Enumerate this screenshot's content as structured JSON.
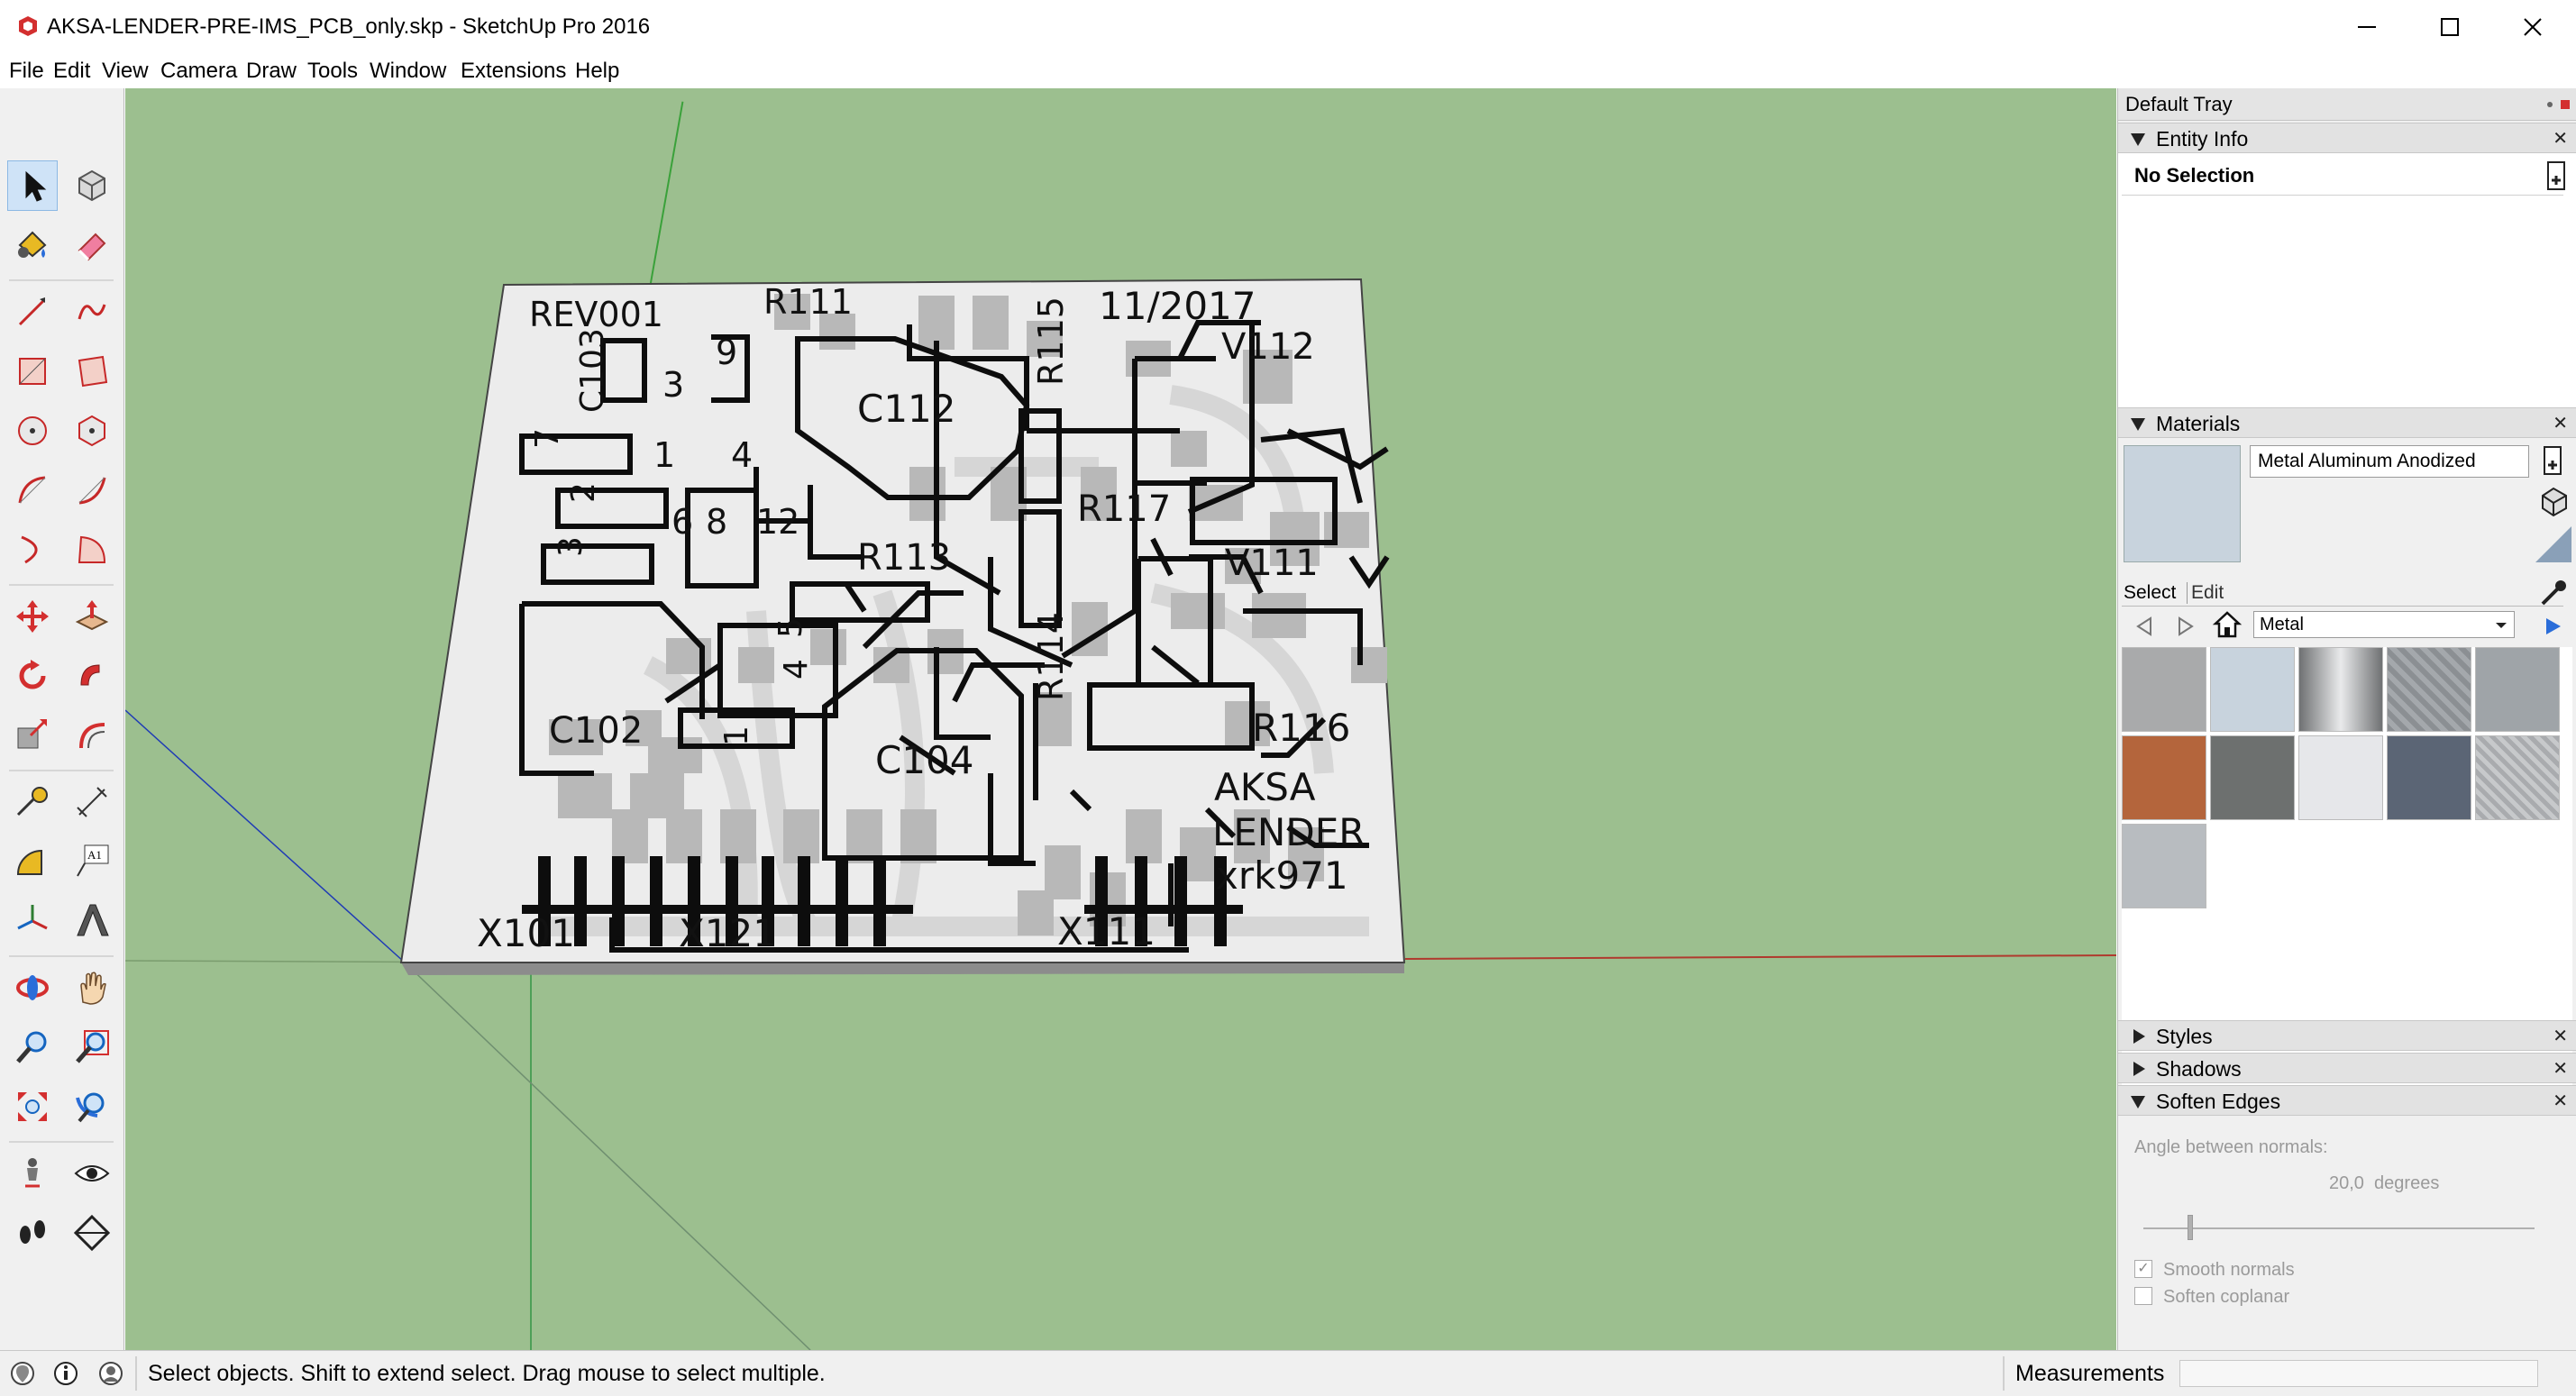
{
  "window": {
    "title": "AKSA-LENDER-PRE-IMS_PCB_only.skp - SketchUp Pro 2016",
    "min_glyph": "—",
    "close_glyph": "✕"
  },
  "menu": [
    "File",
    "Edit",
    "View",
    "Camera",
    "Draw",
    "Tools",
    "Window",
    "Extensions",
    "Help"
  ],
  "toolbar": {
    "tools": [
      "select-icon",
      "make-component-icon",
      "paint-bucket-icon",
      "eraser-icon",
      "line-icon",
      "freehand-icon",
      "rectangle-icon",
      "rotated-rectangle-icon",
      "circle-icon",
      "polygon-icon",
      "arc-icon",
      "two-point-arc-icon",
      "three-point-arc-icon",
      "pie-icon",
      "move-icon",
      "push-pull-icon",
      "rotate-icon",
      "follow-me-icon",
      "scale-icon",
      "offset-icon",
      "tape-measure-icon",
      "dimension-icon",
      "protractor-icon",
      "text-icon",
      "axes-icon",
      "3d-text-icon",
      "orbit-icon",
      "pan-icon",
      "zoom-icon",
      "zoom-window-icon",
      "zoom-extents-icon",
      "previous-view-icon",
      "position-camera-icon",
      "look-around-icon",
      "walk-icon",
      "section-plane-icon"
    ],
    "text_tool_label": "A1"
  },
  "pcb": {
    "labels": [
      "REV001",
      "R111",
      "11/2017",
      "R115",
      "V112",
      "C103",
      "9",
      "3",
      "C112",
      "7",
      "1",
      "4",
      "2",
      "6",
      "8",
      "12",
      "R117",
      "3",
      "R113",
      "V111",
      "5",
      "4",
      "1",
      "R114",
      "C102",
      "C104",
      "R116",
      "AKSA",
      "LENDER",
      "xrk971",
      "X101",
      "X121",
      "X111"
    ]
  },
  "status": {
    "message": "Select objects. Shift to extend select. Drag mouse to select multiple.",
    "measurements_label": "Measurements",
    "measurements_value": ""
  },
  "tray": {
    "title": "Default Tray",
    "entity_info": {
      "title": "Entity Info",
      "selection": "No Selection"
    },
    "materials": {
      "title": "Materials",
      "current_name": "Metal Aluminum Anodized",
      "tab_select": "Select",
      "tab_edit": "Edit",
      "library": "Metal",
      "swatch_colors": [
        "#a9aaab",
        "#c8d3dd",
        "#9b9d9f",
        "#8b8f93",
        "#9fa4a8",
        "#b4653c",
        "#6d706f",
        "#e6e7ea",
        "#5b6575",
        "#c7c9cb",
        "#b8bcc0"
      ]
    },
    "styles_title": "Styles",
    "shadows_title": "Shadows",
    "soften_edges": {
      "title": "Soften Edges",
      "angle_label": "Angle between normals:",
      "angle_value": "20,0  degrees",
      "slider_fraction": 0.12,
      "smooth_normals_label": "Smooth normals",
      "smooth_normals": true,
      "soften_coplanar_label": "Soften coplanar",
      "soften_coplanar": false
    }
  }
}
